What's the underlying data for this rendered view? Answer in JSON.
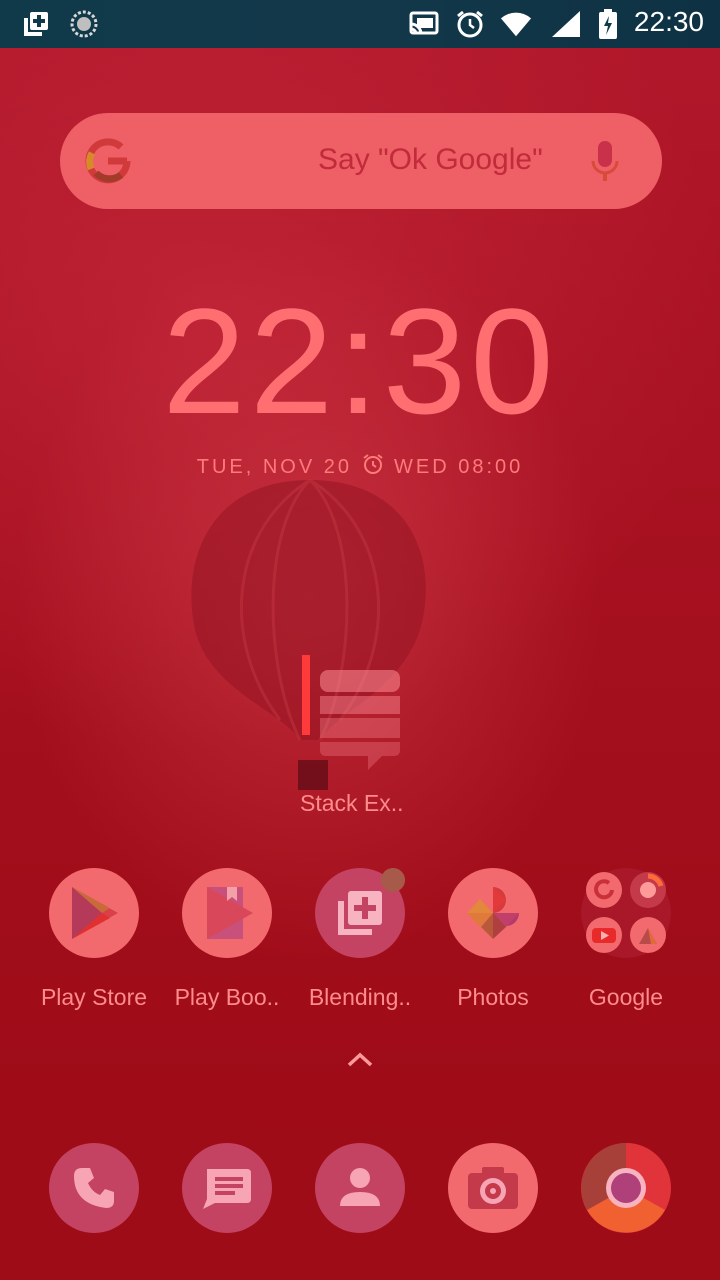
{
  "status_bar": {
    "time": "22:30",
    "left_icons": [
      "blending-app-icon",
      "sync-spinner-icon"
    ],
    "right_icons": [
      "cast-icon",
      "alarm-icon",
      "wifi-icon",
      "signal-icon",
      "battery-charging-icon"
    ]
  },
  "search": {
    "placeholder": "Say \"Ok Google\""
  },
  "clock": {
    "time": "22:30",
    "date": "TUE, NOV 20",
    "alarm": "WED 08:00"
  },
  "workspace": {
    "shortcut": {
      "label": "Stack Ex.."
    }
  },
  "apps": [
    {
      "label": "Play Store",
      "icon": "play-store-icon"
    },
    {
      "label": "Play Boo..",
      "icon": "play-books-icon"
    },
    {
      "label": "Blending..",
      "icon": "blending-icon"
    },
    {
      "label": "Photos",
      "icon": "photos-icon"
    },
    {
      "label": "Google",
      "icon": "google-folder-icon"
    }
  ],
  "dock": [
    {
      "icon": "phone-icon"
    },
    {
      "icon": "messages-icon"
    },
    {
      "icon": "contacts-icon"
    },
    {
      "icon": "camera-icon"
    },
    {
      "icon": "chrome-icon"
    }
  ],
  "colors": {
    "background": "#a81222",
    "search_bar": "#ef5f66",
    "clock_text": "#ff6f72",
    "label_text": "#ff8b8b",
    "status_bar": "#103a4a"
  }
}
